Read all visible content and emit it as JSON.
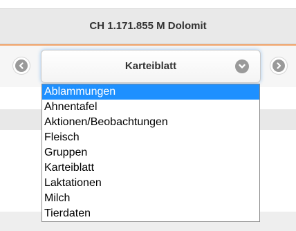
{
  "header": {
    "title": "CH 1.171.855 M Dolomit"
  },
  "toolbar": {
    "selected_view": "Karteiblatt",
    "prev_icon": "chevron-left-icon",
    "next_icon": "chevron-right-icon",
    "dropdown_icon": "chevron-down-icon"
  },
  "dropdown": {
    "options": [
      "Ablammungen",
      "Ahnentafel",
      "Aktionen/Beobachtungen",
      "Fleisch",
      "Gruppen",
      "Karteiblatt",
      "Laktationen",
      "Milch",
      "Tierdaten"
    ],
    "highlighted_index": 0
  },
  "colors": {
    "accent": "#f3a46a",
    "highlight": "#1e90ff",
    "icon": "#9a9a9a"
  }
}
